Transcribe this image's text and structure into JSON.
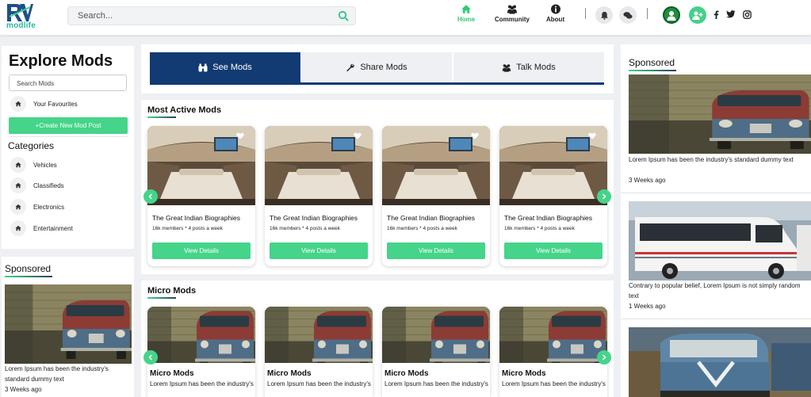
{
  "header": {
    "logo_text": "modlife",
    "search_placeholder": "Search...",
    "nav": [
      {
        "label": "Home",
        "icon": "home-icon",
        "active": true
      },
      {
        "label": "Community",
        "icon": "community-icon",
        "active": false
      },
      {
        "label": "About",
        "icon": "info-icon",
        "active": false
      }
    ],
    "icons": [
      "bell-icon",
      "chat-icon",
      "avatar",
      "add-user-icon",
      "facebook-icon",
      "twitter-icon",
      "instagram-icon"
    ],
    "accent": "#45d48a"
  },
  "left": {
    "title": "Explore Mods",
    "search_placeholder": "Search Mods",
    "favourites_label": "Your Favourites",
    "create_button": "+Create New Mod Post",
    "categories_title": "Categories",
    "categories": [
      "Vehicles",
      "Classifieds",
      "Electronics",
      "Entertainment"
    ]
  },
  "left_sponsored": {
    "title": "Sponsored",
    "text": "Lorem Ipsum has been the industry's standard dummy text",
    "time": "3 Weeks ago"
  },
  "tabs": [
    {
      "label": "See Mods",
      "icon": "binoculars-icon",
      "active": true
    },
    {
      "label": "Share Mods",
      "icon": "wrench-icon",
      "active": false
    },
    {
      "label": "Talk Mods",
      "icon": "users-icon",
      "active": false
    }
  ],
  "most_active": {
    "title": "Most Active Mods",
    "cards": [
      {
        "title": "The Great Indian Biographies",
        "meta": "16k members * 4 posts a week",
        "button": "View Details"
      },
      {
        "title": "The Great Indian Biographies",
        "meta": "16k members * 4 posts a week",
        "button": "View Details"
      },
      {
        "title": "The Great Indian Biographies",
        "meta": "16k members * 4 posts a week",
        "button": "View Details"
      },
      {
        "title": "The Great Indian Biographies",
        "meta": "16k members * 4 posts a week",
        "button": "View Details"
      }
    ]
  },
  "micro_mods": {
    "title": "Micro Mods",
    "cards": [
      {
        "title": "Micro Mods",
        "text": "Lorem Ipsum has been the industry's"
      },
      {
        "title": "Micro Mods",
        "text": "Lorem Ipsum has been the industry's"
      },
      {
        "title": "Micro Mods",
        "text": "Lorem Ipsum has been the industry's"
      },
      {
        "title": "Micro Mods",
        "text": "Lorem Ipsum has been the industry's"
      }
    ]
  },
  "right_sponsored": {
    "title": "Sponsored",
    "items": [
      {
        "text": "Lorem Ipsum has been the industry's standard dummy text",
        "time": "3 Weeks ago"
      },
      {
        "text": "Contrary to popular belief, Lorem Ipsum is not simply random text",
        "time": "1 Weeks ago"
      }
    ]
  }
}
